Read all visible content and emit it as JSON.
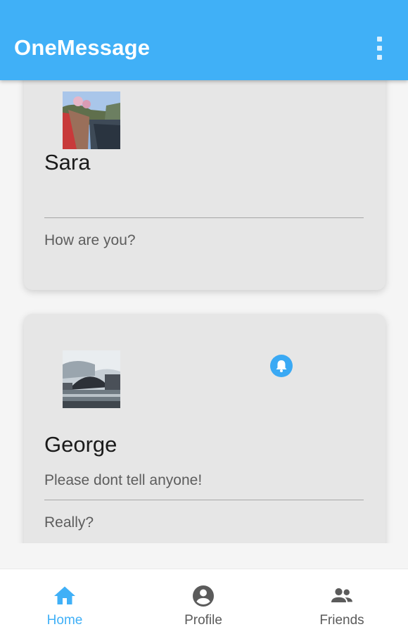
{
  "app": {
    "title": "OneMessage"
  },
  "colors": {
    "accent": "#40b0f7",
    "card": "#e6e6e6",
    "inactive": "#5b5b5b"
  },
  "conversations": [
    {
      "name": "Sara",
      "preview": "",
      "reply": "How are you?",
      "has_notification": false
    },
    {
      "name": "George",
      "preview": "Please dont tell anyone!",
      "reply": "Really?",
      "has_notification": true
    }
  ],
  "icons": {
    "menu": "more-vert-icon",
    "notification": "bell-icon"
  },
  "bottom_nav": {
    "active": "Home",
    "items": [
      {
        "label": "Home",
        "icon": "home-icon"
      },
      {
        "label": "Profile",
        "icon": "account-circle-icon"
      },
      {
        "label": "Friends",
        "icon": "people-icon"
      }
    ]
  }
}
